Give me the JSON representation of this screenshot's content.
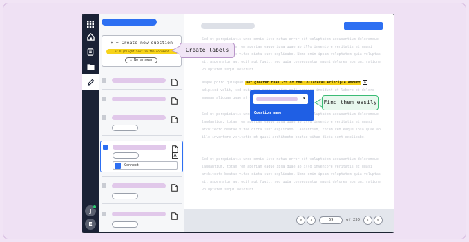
{
  "rail": {
    "icons": [
      "grid-icon",
      "home-icon",
      "document-icon",
      "folder-icon",
      "pen-icon"
    ],
    "avatars": [
      "J",
      "E"
    ]
  },
  "sidebar": {
    "new_question": {
      "label": "✶ + Create new question",
      "highlight_hint": "or highlight text in the document",
      "no_answer": "✕ No answer"
    },
    "selected_question": {
      "connect_label": "Connect"
    }
  },
  "document": {
    "paragraph_1": "Sed ut perspiciatis unde omnis iste natus error sit voluptatem accusantium doloremque laudantium, totam rem aperiam eaque ipsa quae ab illo inventore veritatis et quasi architecto beatae vitae dicta sunt explicabo. Nemo enim ipsam voluptatem quia voluptas sit aspernatur aut odit aut fugit, sed quia consequuntur magni dolores eos qui ratione voluptatem sequi nesciunt.",
    "paragraph_2_before": "Neque porro quisquam",
    "highlight": "not greater than 25% of the Collateral Principle Amount",
    "paragraph_2_after": "adipisci velit, sed quia non numquam eius modi tempora incidunt ut labore et dolore magnam aliquam quaerat voluptatem.",
    "paragraph_3": "Sed ut perspiciatis unde omnis iste natus error sit voluptatem accusantium doloremque laudantium, totam rem aperiam eaque ipsa quae ab illo inventore veritatis et quasi architecto beatae vitae dicta sunt explicabo. Laudantium, totam rem eaque ipsa quae ab illo inventore veritatis et quasi architecto beatae vitae dicta sunt explicabo.",
    "paragraph_4": "Sed ut perspiciatis unde omnis iste natus error sit voluptatem accusantium doloremque laudantium, totam rem aperiam eaque ipsa quae ab illo inventore veritatis et quasi architecto beatae vitae dicta sunt explicabo. Nemo enim ipsam voluptatem quia voluptas sit aspernatur aut odit aut fugit, sed quia consequuntur magni dolores eos qui ratione voluptatem sequi nesciunt."
  },
  "popup": {
    "label": "Question name"
  },
  "pagination": {
    "current_page": "69",
    "of_label": "of 250",
    "first": "«",
    "prev": "‹",
    "next": "›",
    "last": "»"
  },
  "callouts": {
    "create_labels": "Create labels",
    "find_easily": "Find them easily"
  },
  "colors": {
    "accent": "#2d6ff2",
    "highlight": "#f7d31a",
    "rail": "#1b2236",
    "background": "#f1e4f5"
  }
}
